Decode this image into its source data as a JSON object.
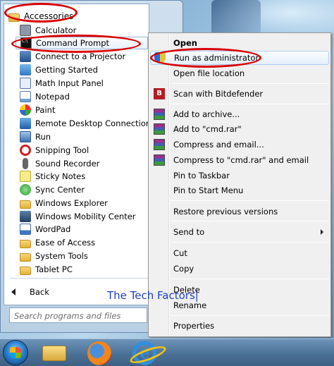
{
  "start_menu": {
    "folder": "Accessories",
    "items": [
      {
        "label": "Calculator",
        "icon": "calculator-icon"
      },
      {
        "label": "Command Prompt",
        "icon": "command-prompt-icon"
      },
      {
        "label": "Connect to a Projector",
        "icon": "projector-icon"
      },
      {
        "label": "Getting Started",
        "icon": "getting-started-icon"
      },
      {
        "label": "Math Input Panel",
        "icon": "math-input-icon"
      },
      {
        "label": "Notepad",
        "icon": "notepad-icon"
      },
      {
        "label": "Paint",
        "icon": "paint-icon"
      },
      {
        "label": "Remote Desktop Connection",
        "icon": "remote-desktop-icon"
      },
      {
        "label": "Run",
        "icon": "run-icon"
      },
      {
        "label": "Snipping Tool",
        "icon": "snipping-tool-icon"
      },
      {
        "label": "Sound Recorder",
        "icon": "microphone-icon"
      },
      {
        "label": "Sticky Notes",
        "icon": "sticky-notes-icon"
      },
      {
        "label": "Sync Center",
        "icon": "sync-center-icon"
      },
      {
        "label": "Windows Explorer",
        "icon": "folder-icon"
      },
      {
        "label": "Windows Mobility Center",
        "icon": "mobility-center-icon"
      },
      {
        "label": "WordPad",
        "icon": "wordpad-icon"
      },
      {
        "label": "Ease of Access",
        "icon": "folder-icon"
      },
      {
        "label": "System Tools",
        "icon": "folder-icon"
      },
      {
        "label": "Tablet PC",
        "icon": "folder-icon"
      }
    ],
    "back_label": "Back",
    "search_placeholder": "Search programs and files"
  },
  "context_menu": {
    "items": [
      {
        "label": "Open",
        "bold": true
      },
      {
        "label": "Run as administrator",
        "icon": "shield-icon"
      },
      {
        "label": "Open file location"
      },
      {
        "label": "Scan with Bitdefender",
        "icon": "bitdefender-icon"
      },
      {
        "label": "Add to archive...",
        "icon": "winrar-icon"
      },
      {
        "label": "Add to \"cmd.rar\"",
        "icon": "winrar-icon"
      },
      {
        "label": "Compress and email...",
        "icon": "winrar-icon"
      },
      {
        "label": "Compress to \"cmd.rar\" and email",
        "icon": "winrar-icon"
      },
      {
        "label": "Pin to Taskbar"
      },
      {
        "label": "Pin to Start Menu"
      },
      {
        "label": "Restore previous versions"
      },
      {
        "label": "Send to",
        "submenu": true
      },
      {
        "label": "Cut"
      },
      {
        "label": "Copy"
      },
      {
        "label": "Delete"
      },
      {
        "label": "Rename"
      },
      {
        "label": "Properties"
      }
    ]
  },
  "watermark": "The Tech Factors|",
  "colors": {
    "highlight_oval": "#d80000",
    "watermark": "#1f3fbf"
  }
}
